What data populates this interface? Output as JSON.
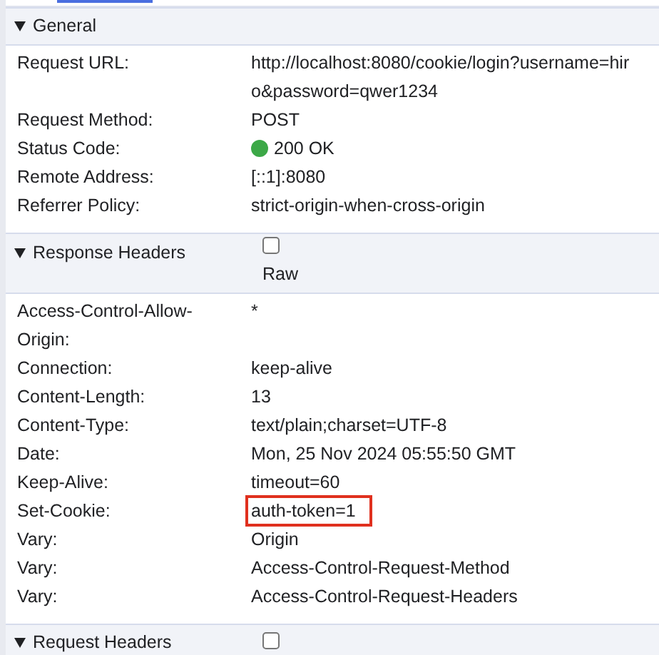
{
  "sections": [
    {
      "title": "General",
      "expanded": true,
      "rows": [
        {
          "name": "Request URL:",
          "value_lines": [
            "http://localhost:8080/cookie/login?username=hir",
            "o&password=qwer1234"
          ]
        },
        {
          "name": "Request Method:",
          "value_lines": [
            "POST"
          ]
        },
        {
          "name": "Status Code:",
          "value_lines": [
            "200 OK"
          ],
          "color": "#3ca847"
        },
        {
          "name": "Remote Address:",
          "value_lines": [
            "[::1]:8080"
          ]
        },
        {
          "name": "Referrer Policy:",
          "value_lines": [
            "strict-origin-when-cross-origin"
          ]
        }
      ]
    },
    {
      "title": "Response Headers",
      "expanded": true,
      "raw_checkbox": {
        "label": "Raw",
        "checked": false
      },
      "rows": [
        {
          "name": "Access-Control-Allow-Origin:",
          "value_lines": [
            "*"
          ]
        },
        {
          "name": "Connection:",
          "value_lines": [
            "keep-alive"
          ]
        },
        {
          "name": "Content-Length:",
          "value_lines": [
            "13"
          ]
        },
        {
          "name": "Content-Type:",
          "value_lines": [
            "text/plain;charset=UTF-8"
          ]
        },
        {
          "name": "Date:",
          "value_lines": [
            "Mon, 25 Nov 2024 05:55:50 GMT"
          ]
        },
        {
          "name": "Keep-Alive:",
          "value_lines": [
            "timeout=60"
          ]
        },
        {
          "name": "Set-Cookie:",
          "value_lines": [
            "auth-token=1"
          ],
          "highlighted": true
        },
        {
          "name": "Vary:",
          "value_lines": [
            "Origin"
          ]
        },
        {
          "name": "Vary:",
          "value_lines": [
            "Access-Control-Request-Method"
          ]
        },
        {
          "name": "Vary:",
          "value_lines": [
            "Access-Control-Request-Headers"
          ]
        }
      ]
    },
    {
      "title": "Request Headers",
      "expanded": true,
      "raw_checkbox": {
        "checked": false
      }
    }
  ]
}
